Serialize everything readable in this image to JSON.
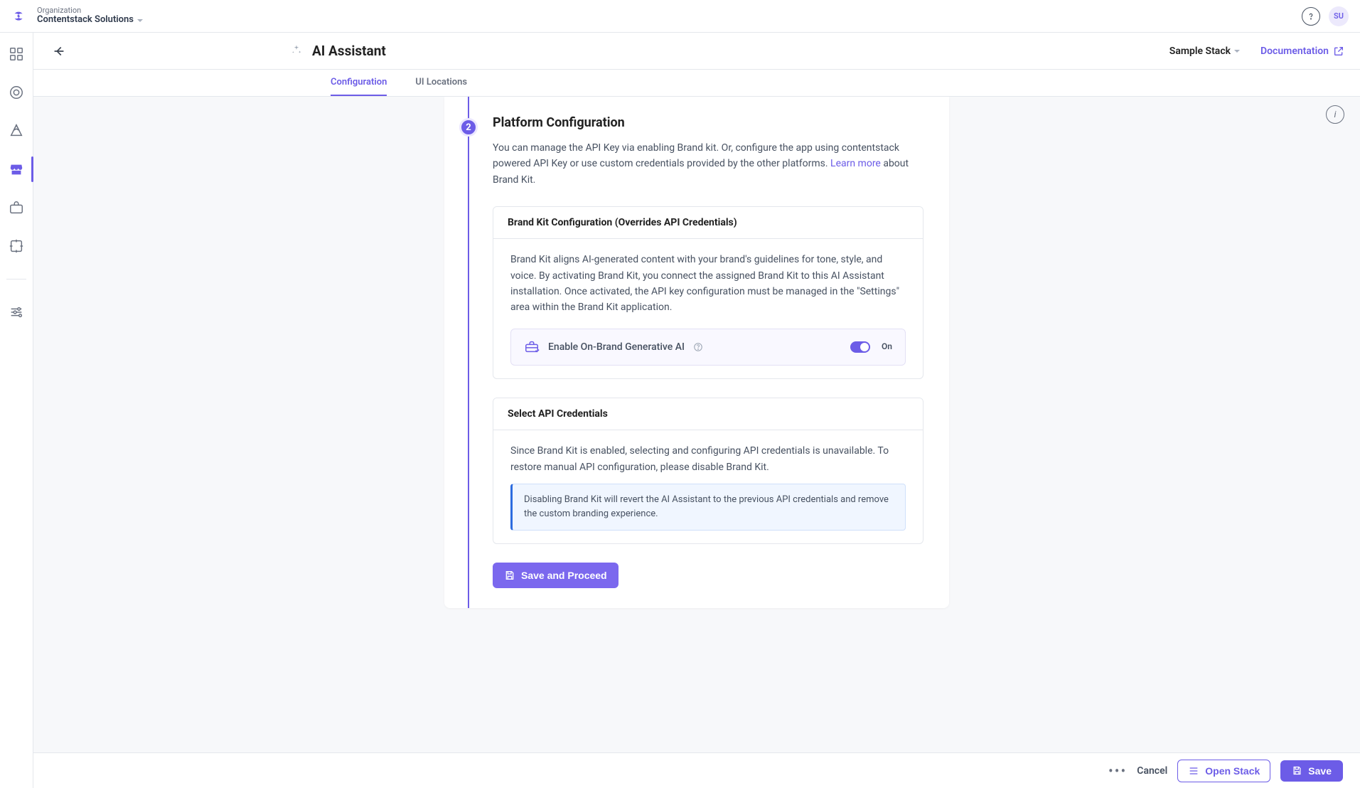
{
  "org": {
    "label": "Organization",
    "name": "Contentstack Solutions"
  },
  "user": {
    "initials": "SU"
  },
  "header": {
    "title": "AI Assistant",
    "stack": "Sample Stack",
    "docLink": "Documentation"
  },
  "tabs": [
    {
      "label": "Configuration",
      "active": true
    },
    {
      "label": "UI Locations",
      "active": false
    }
  ],
  "stepper": {
    "current": "2"
  },
  "section": {
    "title": "Platform Configuration",
    "desc_before": "You can manage the API Key via enabling Brand kit. Or, configure the app using contentstack powered API Key or use custom credentials provided by the other platforms. ",
    "learnMore": "Learn more",
    "desc_after": " about Brand Kit."
  },
  "brandKit": {
    "panelTitle": "Brand Kit Configuration (Overrides API Credentials)",
    "panelDesc": "Brand Kit aligns AI-generated content with your brand's guidelines for tone, style, and voice. By activating Brand Kit, you connect the assigned Brand Kit to this AI Assistant installation. Once activated, the API key configuration must be managed in the \"Settings\" area within the Brand Kit application.",
    "toggleLabel": "Enable On-Brand Generative AI",
    "toggleState": "On"
  },
  "apiCred": {
    "panelTitle": "Select API Credentials",
    "panelDesc": "Since Brand Kit is enabled, selecting and configuring API credentials is unavailable. To restore manual API configuration, please disable Brand Kit.",
    "info": "Disabling Brand Kit will revert the AI Assistant to the previous API credentials and remove the custom branding experience."
  },
  "actions": {
    "saveProceed": "Save and Proceed",
    "cancel": "Cancel",
    "openStack": "Open Stack",
    "save": "Save"
  }
}
